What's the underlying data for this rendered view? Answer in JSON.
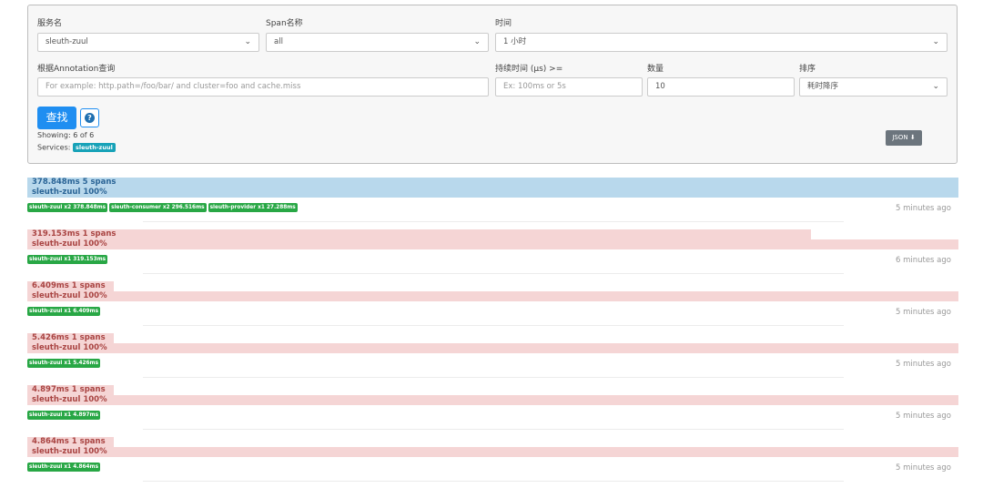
{
  "form": {
    "service_label": "服务名",
    "service_value": "sleuth-zuul",
    "span_label": "Span名称",
    "span_value": "all",
    "time_label": "时间",
    "time_value": "1 小时",
    "annotation_label": "根据Annotation查询",
    "annotation_placeholder": "For example: http.path=/foo/bar/ and cluster=foo and cache.miss",
    "duration_label": "持续时间 (μs) >=",
    "duration_placeholder": "Ex: 100ms or 5s",
    "limit_label": "数量",
    "limit_value": "10",
    "sort_label": "排序",
    "sort_value": "耗时降序",
    "find_button": "查找",
    "help_icon": "?",
    "showing": "Showing: 6 of 6",
    "services_label": "Services:",
    "services_badge": "sleuth-zuul",
    "json_button": "JSON"
  },
  "traces": [
    {
      "duration_spans": "378.848ms   5 spans",
      "service_pct": "sleuth-zuul 100%",
      "bar_fraction": 1.0,
      "color": "blue",
      "tags": [
        "sleuth-zuul x2 378.848ms",
        "sleuth-consumer x2 296.516ms",
        "sleuth-provider x1 27.288ms"
      ],
      "ago": "5 minutes ago"
    },
    {
      "duration_spans": "319.153ms   1 spans",
      "service_pct": "sleuth-zuul 100%",
      "bar_fraction": 0.842,
      "color": "red",
      "tags": [
        "sleuth-zuul x1 319.153ms"
      ],
      "ago": "6 minutes ago"
    },
    {
      "duration_spans": "6.409ms   1 spans",
      "service_pct": "sleuth-zuul 100%",
      "bar_fraction": 0.017,
      "color": "red",
      "tags": [
        "sleuth-zuul x1 6.409ms"
      ],
      "ago": "5 minutes ago"
    },
    {
      "duration_spans": "5.426ms   1 spans",
      "service_pct": "sleuth-zuul 100%",
      "bar_fraction": 0.014,
      "color": "red",
      "tags": [
        "sleuth-zuul x1 5.426ms"
      ],
      "ago": "5 minutes ago"
    },
    {
      "duration_spans": "4.897ms   1 spans",
      "service_pct": "sleuth-zuul 100%",
      "bar_fraction": 0.013,
      "color": "red",
      "tags": [
        "sleuth-zuul x1 4.897ms"
      ],
      "ago": "5 minutes ago"
    },
    {
      "duration_spans": "4.864ms   1 spans",
      "service_pct": "sleuth-zuul 100%",
      "bar_fraction": 0.013,
      "color": "red",
      "tags": [
        "sleuth-zuul x1 4.864ms"
      ],
      "ago": "5 minutes ago"
    }
  ]
}
